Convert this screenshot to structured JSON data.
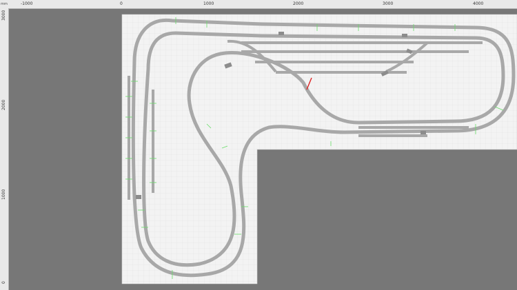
{
  "ruler": {
    "unit": "mm",
    "x_labels": [
      "-1000",
      "0",
      "1000",
      "2000",
      "3000",
      "4000"
    ],
    "y_labels": [
      "3000",
      "2000",
      "1000",
      "0"
    ]
  },
  "layout": {
    "colors": {
      "background": "#777777",
      "board": "#f2f2f2",
      "grid": "#dcdcdc",
      "track": "#a9a9a9",
      "turnout": "#8d8d8d",
      "joint": "#66dd66",
      "marker": "#dd2222",
      "label": "#222222"
    }
  }
}
